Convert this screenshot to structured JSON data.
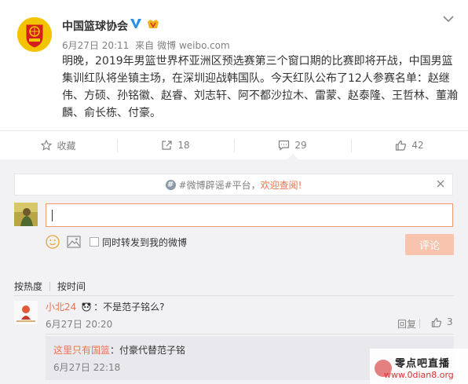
{
  "post": {
    "author": "中国篮球协会",
    "date": "6月27日 20:11",
    "source_prefix": "来自",
    "source": "微博 weibo.com",
    "text": "明晚，2019年男篮世界杯亚洲区预选赛第三个窗口期的比赛即将开战，中国男篮集训红队将坐镇主场，在深圳迎战韩国队。今天红队公布了12人参赛名单：赵继伟、方硕、孙铭徽、赵睿、刘志轩、阿不都沙拉木、雷蒙、赵泰隆、王哲林、董瀚麟、俞长栋、付豪。"
  },
  "actions": {
    "favorite": "收藏",
    "repost_count": "18",
    "comment_count": "29",
    "like_count": "42"
  },
  "notice": {
    "prefix": "#微博辟谣#平台，",
    "link": "欢迎查阅!"
  },
  "composer": {
    "repost_label": "同时转发到我的微博",
    "submit": "评论"
  },
  "sort": {
    "hot": "按热度",
    "time": "按时间"
  },
  "comment": {
    "user": "小北24",
    "text": "：不是范子铭么?",
    "time": "6月27日 20:20",
    "reply_label": "回复",
    "like_count": "3"
  },
  "reply": {
    "user": "这里只有国篮",
    "text": "：付豪代替范子铭",
    "time": "6月27日 22:18"
  },
  "watermark": {
    "title": "零点吧直播",
    "url": "www.0dian8.org"
  },
  "colors": {
    "accent": "#eb7350",
    "muted": "#808080",
    "panel": "#f2f2f5",
    "submit_disabled": "#f8c4ad"
  },
  "icons": [
    "verified-icon",
    "vip-icon",
    "chevron-down-icon",
    "star-icon",
    "repost-icon",
    "comment-icon",
    "thumb-up-icon",
    "info-icon",
    "close-icon",
    "emoji-icon",
    "image-icon",
    "checkbox"
  ]
}
